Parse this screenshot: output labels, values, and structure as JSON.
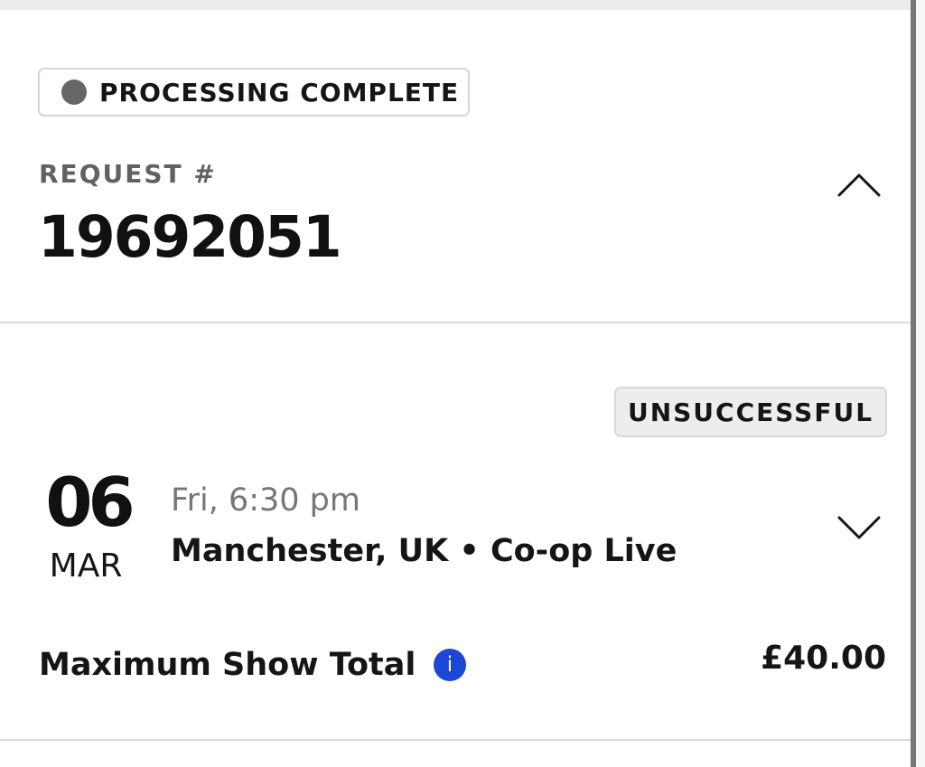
{
  "request": {
    "status": "PROCESSING COMPLETE",
    "label": "REQUEST #",
    "number": "19692051",
    "collapse_icon": "chevron-up-icon"
  },
  "event": {
    "result": "UNSUCCESSFUL",
    "day": "06",
    "month": "MAR",
    "time": "Fri, 6:30 pm",
    "location": "Manchester, UK • Co-op Live",
    "expand_icon": "chevron-down-icon"
  },
  "summary": {
    "label": "Maximum Show Total",
    "info_icon": "info-icon",
    "amount": "£40.00"
  },
  "colors": {
    "status_dot": "#666666",
    "info_icon": "#1b47d6",
    "divider": "#d9d9d9"
  }
}
